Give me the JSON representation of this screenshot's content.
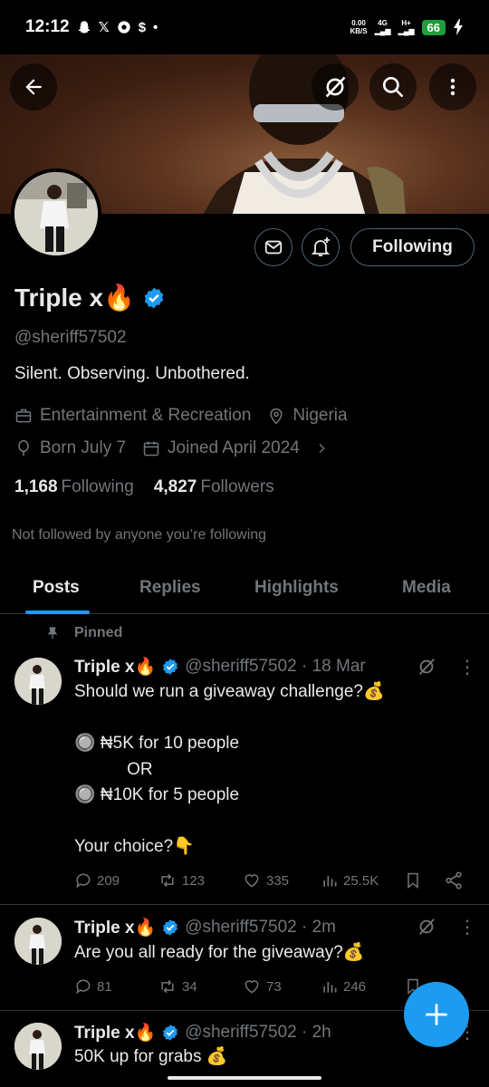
{
  "status_bar": {
    "time": "12:12",
    "icons": [
      "snapchat-icon",
      "x-icon",
      "gaming-icon",
      "s-icon",
      "dot-icon"
    ],
    "net_speed": "0.00\nKB/S",
    "net_4g": "4G",
    "net_hplus": "H+",
    "battery": "66"
  },
  "header": {
    "back_label": "Back",
    "grok_label": "Grok",
    "search_label": "Search",
    "more_label": "More"
  },
  "profile": {
    "display_name": "Triple x🔥",
    "handle": "@sheriff57502",
    "bio": "Silent. Observing. Unbothered.",
    "category": "Entertainment & Recreation",
    "location": "Nigeria",
    "birthday": "Born July 7",
    "joined": "Joined April 2024",
    "following_count": "1,168",
    "following_label": "Following",
    "followers_count": "4,827",
    "followers_label": "Followers",
    "not_followed": "Not followed by anyone you’re following",
    "follow_button": "Following",
    "verified_color": "#1d9bf0"
  },
  "tabs": [
    "Posts",
    "Replies",
    "Highlights",
    "Media"
  ],
  "pinned_label": "Pinned",
  "tweets": [
    {
      "name": "Triple x🔥",
      "handle": "@sheriff57502 · 18 Mar",
      "text": "Should we run a giveaway challenge?💰\n\n🔘 ₦5K for 10 people\n           OR\n🔘 ₦10K for 5 people\n\nYour choice?👇",
      "replies": "209",
      "retweets": "123",
      "likes": "335",
      "views": "25.5K"
    },
    {
      "name": "Triple x🔥",
      "handle": "@sheriff57502 · 2m",
      "text": "Are you all ready for the giveaway?💰",
      "replies": "81",
      "retweets": "34",
      "likes": "73",
      "views": "246"
    },
    {
      "name": "Triple x🔥",
      "handle": "@sheriff57502 · 2h",
      "text": "50K up for grabs 💰"
    }
  ],
  "fab_label": "+",
  "colors": {
    "accent": "#1d9bf0",
    "background": "#000000",
    "secondary_text": "#71767b",
    "border": "#2f3336"
  }
}
